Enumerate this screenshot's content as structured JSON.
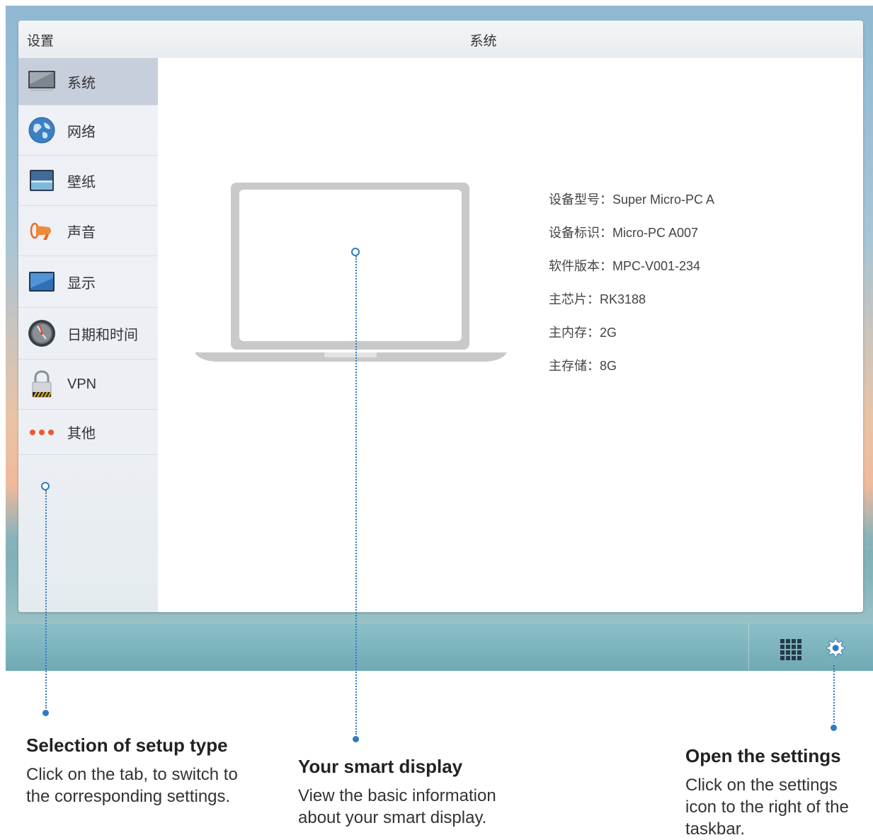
{
  "window": {
    "app_title": "设置",
    "title": "系统"
  },
  "sidebar": {
    "items": [
      {
        "label": "系统",
        "icon": "monitor-icon",
        "active": true
      },
      {
        "label": "网络",
        "icon": "globe-icon",
        "active": false
      },
      {
        "label": "壁纸",
        "icon": "wallpaper-icon",
        "active": false
      },
      {
        "label": "声音",
        "icon": "speaker-icon",
        "active": false
      },
      {
        "label": "显示",
        "icon": "display-icon",
        "active": false
      },
      {
        "label": "日期和时间",
        "icon": "clock-icon",
        "active": false
      },
      {
        "label": "VPN",
        "icon": "lock-icon",
        "active": false
      },
      {
        "label": "其他",
        "icon": "more-dots-icon",
        "active": false
      }
    ]
  },
  "system_info": {
    "rows": [
      "设备型号：Super Micro-PC A",
      "设备标识：Micro-PC A007",
      "软件版本：MPC-V001-234",
      "主芯片：RK3188",
      "主内存：2G",
      "主存储：8G"
    ]
  },
  "taskbar": {
    "icons": [
      "apps-grid-icon",
      "gear-icon"
    ]
  },
  "callouts": {
    "setup": {
      "title": "Selection of setup type",
      "lines": [
        "Click on the tab, to switch to",
        "the corresponding settings."
      ]
    },
    "display": {
      "title": "Your smart display",
      "lines": [
        "View the basic information",
        "about your smart display."
      ]
    },
    "settings": {
      "title": "Open the settings",
      "lines": [
        "Click on the settings",
        "icon to the right of the",
        "taskbar."
      ]
    }
  },
  "colors": {
    "accent": "#2f7ac4",
    "sidebar_active": "#c8cfdc"
  }
}
